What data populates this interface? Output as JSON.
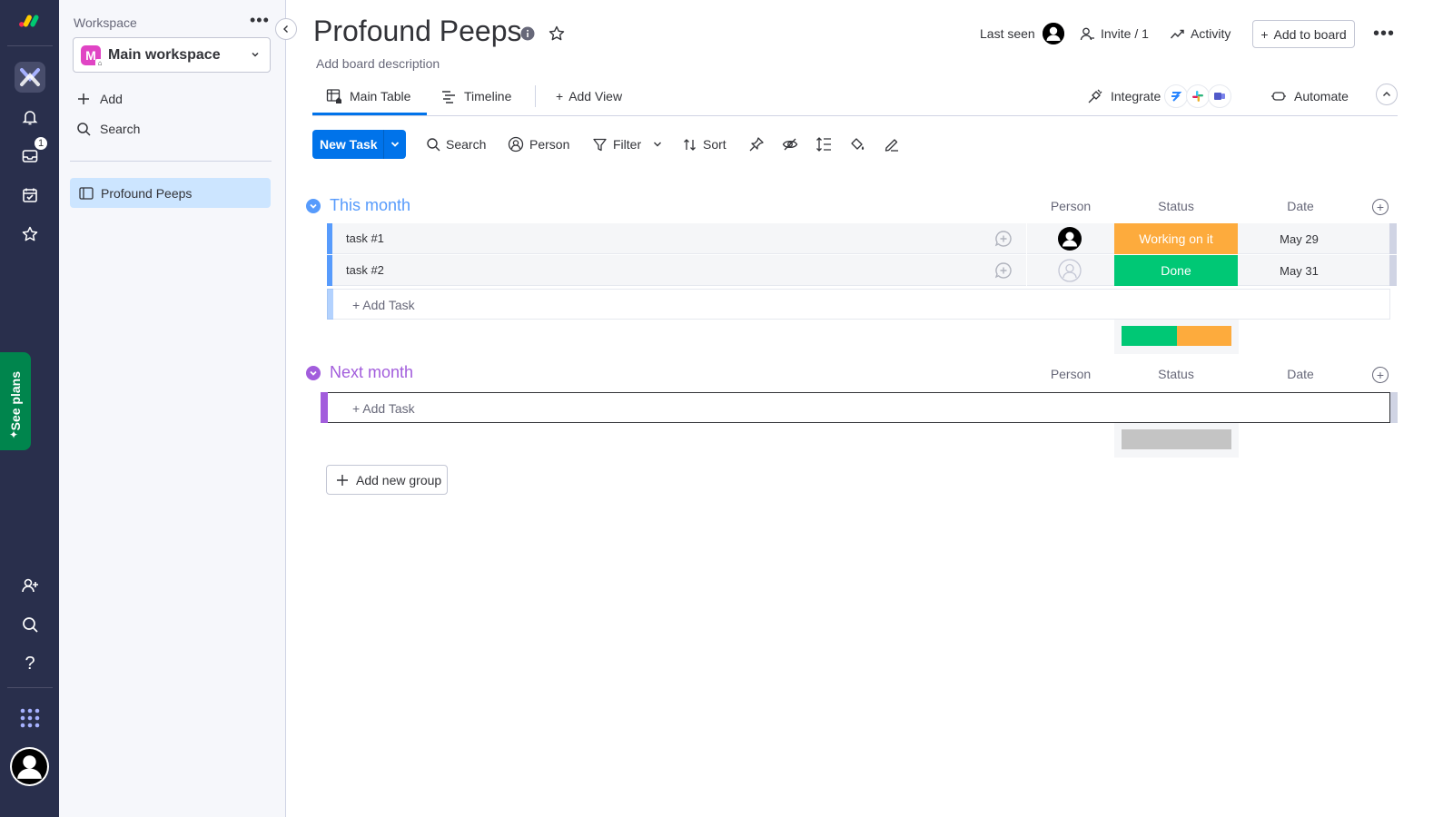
{
  "rail": {
    "inbox_badge": "1",
    "see_plans": "See plans"
  },
  "workspace": {
    "label": "Workspace",
    "selected_initial": "M",
    "selected_name": "Main workspace",
    "add_label": "Add",
    "search_label": "Search",
    "boards": [
      {
        "name": "Profound Peeps"
      }
    ]
  },
  "board": {
    "title": "Profound Peeps",
    "description": "Add board description",
    "last_seen_label": "Last seen",
    "invite_label": "Invite / 1",
    "activity_label": "Activity",
    "add_to_board_label": "Add to board"
  },
  "views": {
    "tabs": [
      {
        "label": "Main Table"
      },
      {
        "label": "Timeline"
      }
    ],
    "add_view_label": "Add View",
    "integrate_label": "Integrate",
    "automate_label": "Automate"
  },
  "toolbar": {
    "new_task_label": "New Task",
    "search_label": "Search",
    "person_label": "Person",
    "filter_label": "Filter",
    "sort_label": "Sort"
  },
  "columns": {
    "person": "Person",
    "status": "Status",
    "date": "Date"
  },
  "groups": [
    {
      "title": "This month",
      "color": "#579bfc",
      "tasks": [
        {
          "name": "task #1",
          "status": "Working on it",
          "status_color": "#fdab3d",
          "date": "May 29",
          "person_assigned": true
        },
        {
          "name": "task #2",
          "status": "Done",
          "status_color": "#00c875",
          "date": "May 31",
          "person_assigned": false
        }
      ],
      "add_task_label": "+ Add Task",
      "status_summary": [
        {
          "color": "#00c875",
          "fraction": 0.5
        },
        {
          "color": "#fdab3d",
          "fraction": 0.5
        }
      ]
    },
    {
      "title": "Next month",
      "color": "#a25ddc",
      "tasks": [],
      "add_task_label": "+ Add Task",
      "status_summary": [
        {
          "color": "#c4c4c4",
          "fraction": 1
        }
      ]
    }
  ],
  "add_group_label": "Add new group",
  "colors": {
    "primary": "#0073ea",
    "rail_bg": "#292f4c",
    "selected_board_bg": "#cce5ff"
  }
}
